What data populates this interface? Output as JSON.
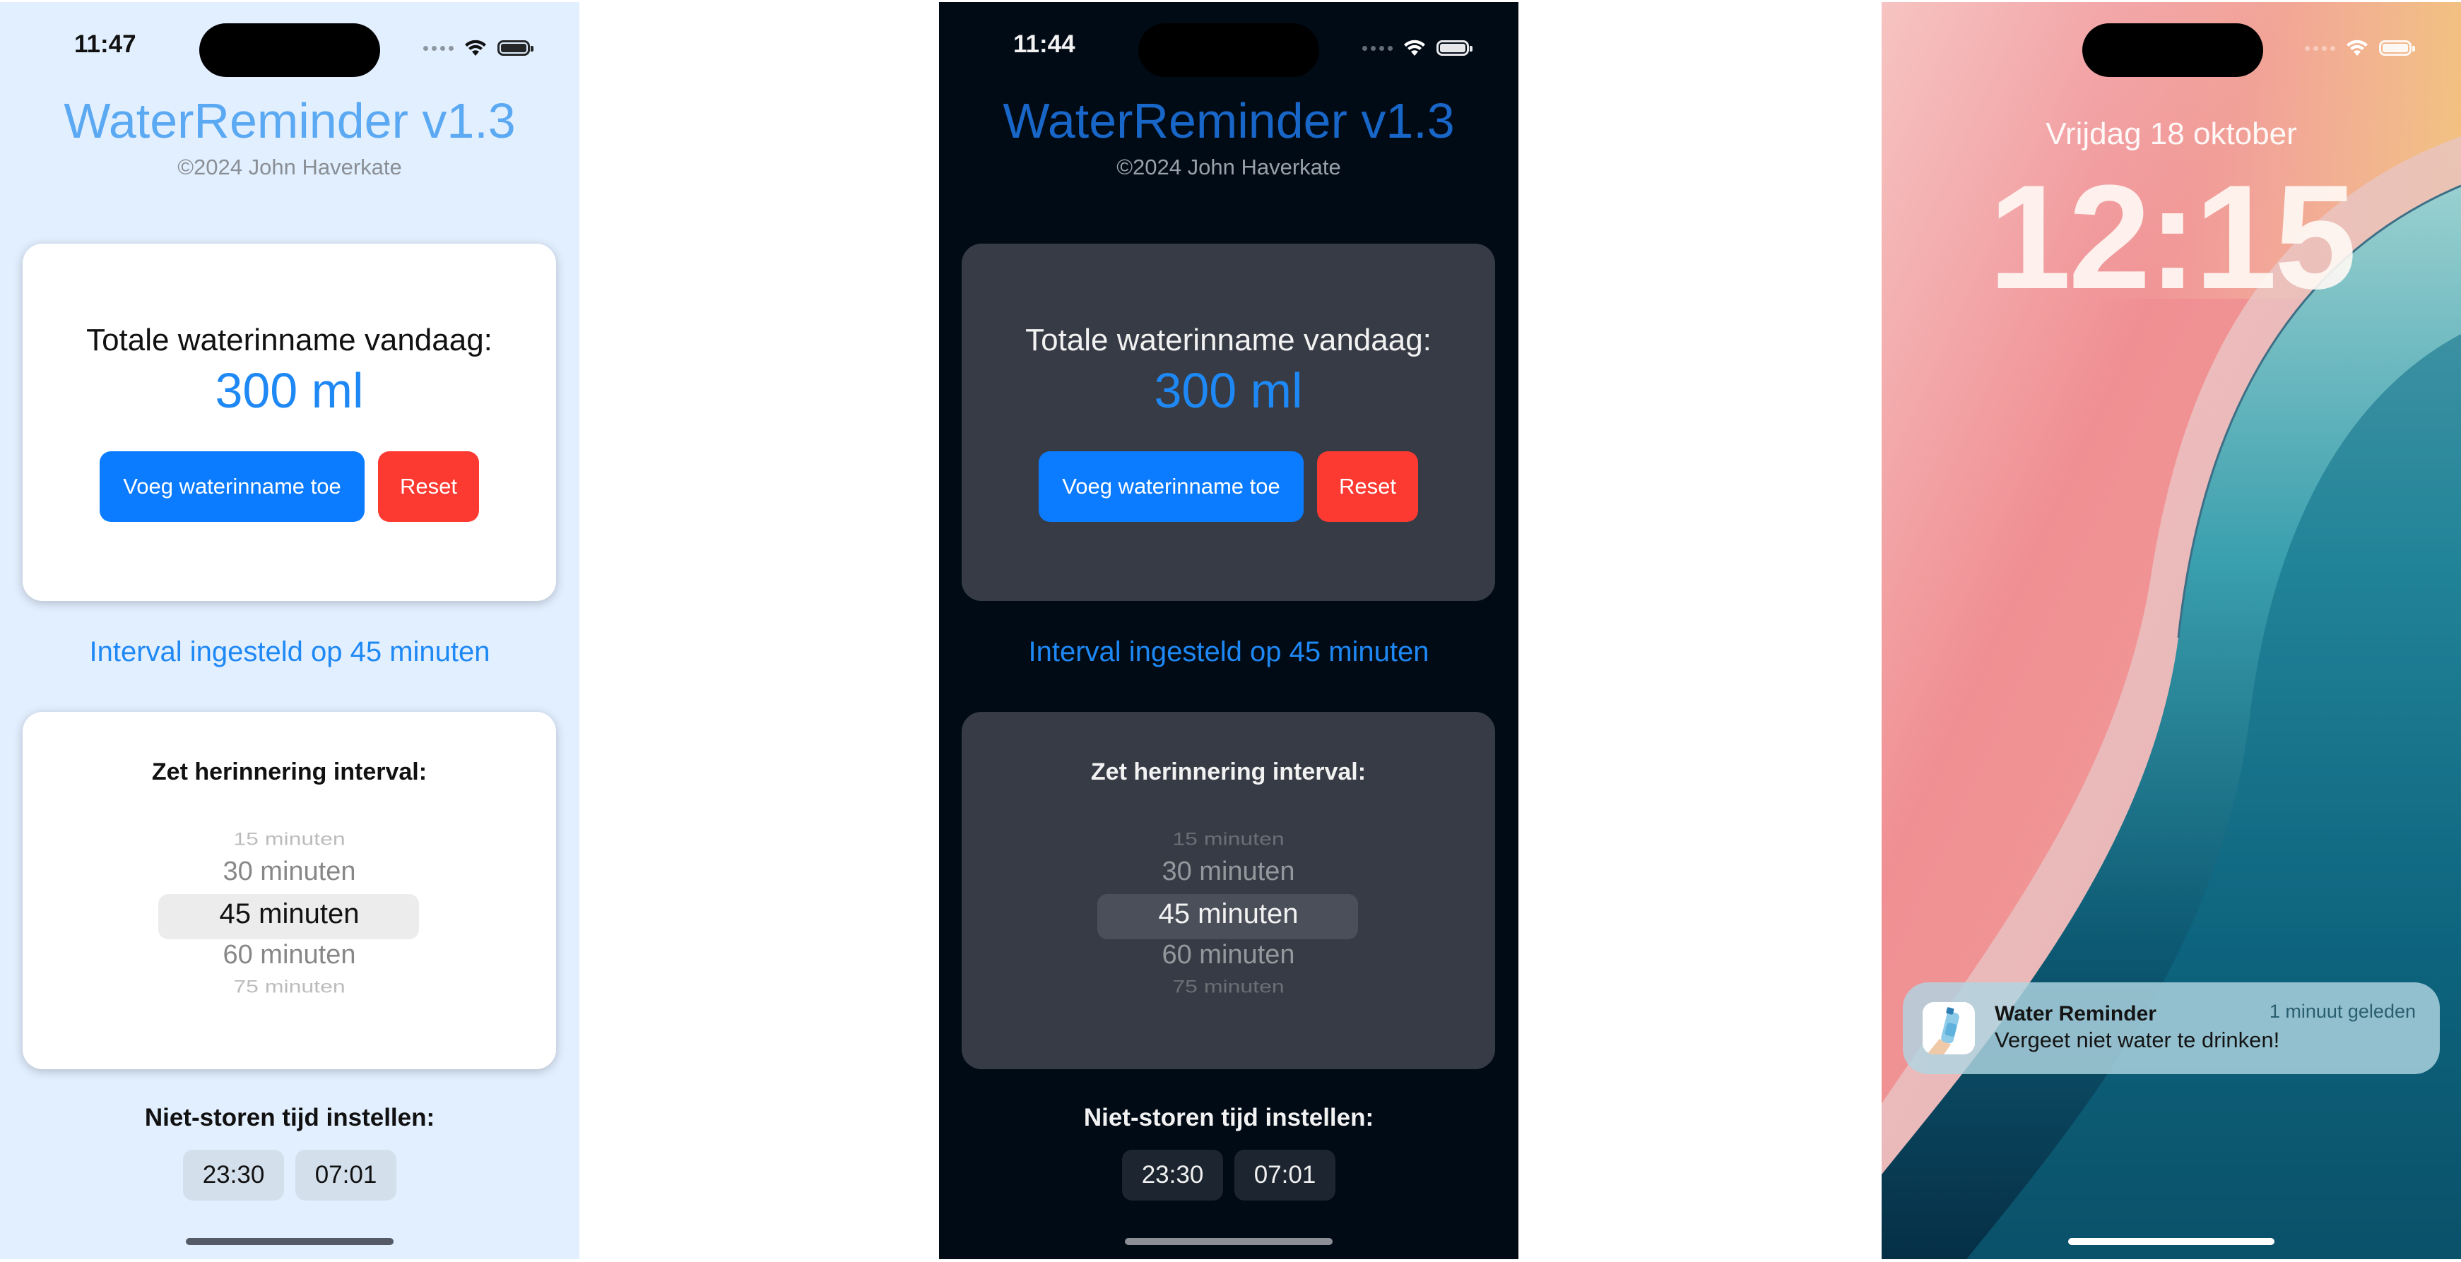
{
  "light_screen": {
    "status_time": "11:47",
    "app_title": "WaterReminder v1.3",
    "copyright": "©2024 John Haverkate",
    "intake_label": "Totale waterinname vandaag:",
    "intake_value": "300 ml",
    "add_button": "Voeg waterinname toe",
    "reset_button": "Reset",
    "interval_status": "Interval ingesteld op 45 minuten",
    "picker_label": "Zet herinnering interval:",
    "picker_options": [
      "15 minuten",
      "30 minuten",
      "45 minuten",
      "60 minuten",
      "75 minuten"
    ],
    "picker_selected": "45 minuten",
    "dnd_label": "Niet-storen tijd instellen:",
    "dnd_start": "23:30",
    "dnd_end": "07:01"
  },
  "dark_screen": {
    "status_time": "11:44",
    "app_title": "WaterReminder v1.3",
    "copyright": "©2024 John Haverkate",
    "intake_label": "Totale waterinname vandaag:",
    "intake_value": "300 ml",
    "add_button": "Voeg waterinname toe",
    "reset_button": "Reset",
    "interval_status": "Interval ingesteld op 45 minuten",
    "picker_label": "Zet herinnering interval:",
    "picker_options": [
      "15 minuten",
      "30 minuten",
      "45 minuten",
      "60 minuten",
      "75 minuten"
    ],
    "picker_selected": "45 minuten",
    "dnd_label": "Niet-storen tijd instellen:",
    "dnd_start": "23:30",
    "dnd_end": "07:01"
  },
  "lock_screen": {
    "date": "Vrijdag 18 oktober",
    "time": "12:15",
    "notification": {
      "app_name": "Water Reminder",
      "time_ago": "1 minuut geleden",
      "message": "Vergeet niet water te drinken!"
    }
  },
  "icons": [
    "cellular-signal-icon",
    "wifi-icon",
    "battery-icon",
    "water-bottle-app-icon"
  ],
  "colors": {
    "light_background": "#e2efff",
    "dark_background": "#010b16",
    "accent_blue": "#0b7bff",
    "reset_red": "#fc3a32",
    "intake_value_blue": "#1e88f5"
  }
}
